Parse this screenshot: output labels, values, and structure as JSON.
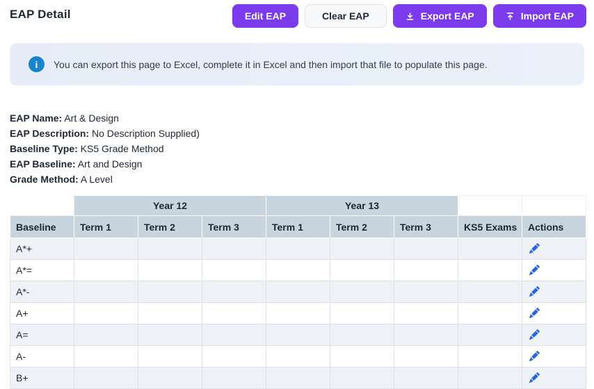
{
  "page": {
    "title": "EAP Detail"
  },
  "toolbar": {
    "edit_label": "Edit EAP",
    "clear_label": "Clear EAP",
    "export_label": "Export EAP",
    "import_label": "Import EAP"
  },
  "banner": {
    "text": "You can export this page to Excel, complete it in Excel and then import that file to populate this page.",
    "icon": "info-icon",
    "icon_glyph": "i"
  },
  "details": [
    {
      "label": "EAP Name:",
      "value": "Art & Design"
    },
    {
      "label": "EAP Description:",
      "value": "No Description Supplied)"
    },
    {
      "label": "Baseline Type:",
      "value": "KS5 Grade Method"
    },
    {
      "label": "EAP Baseline:",
      "value": "Art and Design"
    },
    {
      "label": "Grade Method:",
      "value": "A Level"
    }
  ],
  "table": {
    "group_headers": {
      "year12": "Year 12",
      "year13": "Year 13"
    },
    "columns": [
      "Baseline",
      "Term 1",
      "Term 2",
      "Term 3",
      "Term 1",
      "Term 2",
      "Term 3",
      "KS5 Exams",
      "Actions"
    ],
    "rows": [
      {
        "baseline": "A*+",
        "cells": [
          "",
          "",
          "",
          "",
          "",
          "",
          ""
        ]
      },
      {
        "baseline": "A*=",
        "cells": [
          "",
          "",
          "",
          "",
          "",
          "",
          ""
        ]
      },
      {
        "baseline": "A*-",
        "cells": [
          "",
          "",
          "",
          "",
          "",
          "",
          ""
        ]
      },
      {
        "baseline": "A+",
        "cells": [
          "",
          "",
          "",
          "",
          "",
          "",
          ""
        ]
      },
      {
        "baseline": "A=",
        "cells": [
          "",
          "",
          "",
          "",
          "",
          "",
          ""
        ]
      },
      {
        "baseline": "A-",
        "cells": [
          "",
          "",
          "",
          "",
          "",
          "",
          ""
        ]
      },
      {
        "baseline": "B+",
        "cells": [
          "",
          "",
          "",
          "",
          "",
          "",
          ""
        ]
      }
    ],
    "row_action_icon": "pencil-icon"
  },
  "icons": {
    "export": "download-icon",
    "import": "upload-icon",
    "info": "info-icon",
    "edit_row": "pencil-icon"
  },
  "colors": {
    "accent_purple": "#7c3aed",
    "table_header_bg": "#c8d4de",
    "row_stripe_bg": "#eef1f6",
    "info_banner_bg": "#e8f0fa",
    "info_icon_blue": "#1983ce",
    "edit_icon_blue": "#2563eb"
  }
}
